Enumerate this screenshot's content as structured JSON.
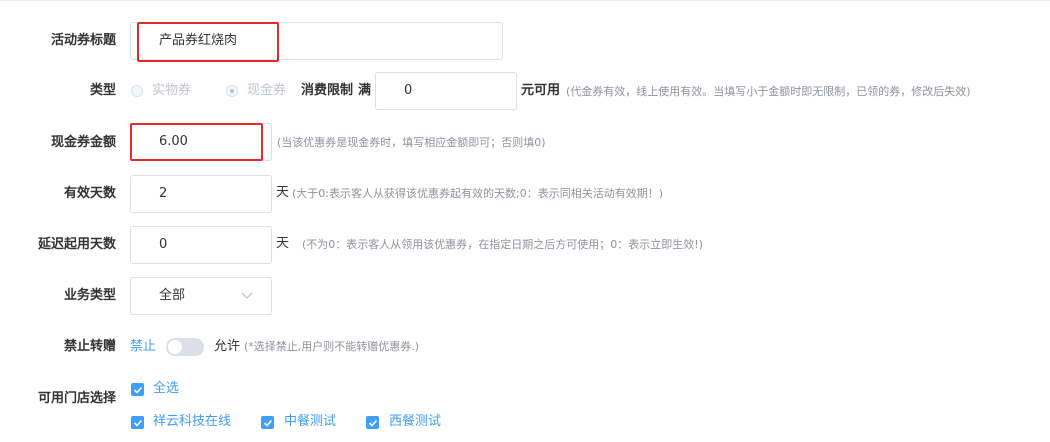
{
  "form": {
    "title": {
      "label": "活动券标题",
      "value": "产品券红烧肉"
    },
    "type": {
      "label": "类型",
      "options": [
        "实物券",
        "现金券"
      ],
      "selected": "现金券",
      "limit_label": "消费限制",
      "limit_prefix": "满",
      "limit_value": "0",
      "limit_suffix": "元可用",
      "limit_hint": "(代金券有效，线上使用有效。当填写小于金额时即无限制，已领的券，修改后失效)"
    },
    "amount": {
      "label": "现金券金额",
      "value": "6.00",
      "hint": "(当该优惠券是现金券时，填写相应金额即可；否则填0)"
    },
    "valid_days": {
      "label": "有效天数",
      "value": "2",
      "unit": "天",
      "hint": "(大于0:表示客人从获得该优惠券起有效的天数;0：表示同相关活动有效期！)"
    },
    "delay_days": {
      "label": "延迟起用天数",
      "value": "0",
      "unit": "天",
      "hint": "(不为0：表示客人从领用该优惠券，在指定日期之后方可使用；0：表示立即生效!)"
    },
    "business_type": {
      "label": "业务类型",
      "value": "全部"
    },
    "transfer": {
      "label": "禁止转赠",
      "off_label": "禁止",
      "on_label": "允许",
      "state": "off",
      "hint": "(*选择禁止,用户则不能转赠优惠券.)"
    },
    "stores": {
      "label": "可用门店选择",
      "select_all": "全选",
      "items": [
        "祥云科技在线",
        "中餐测试",
        "西餐测试"
      ]
    }
  },
  "colors": {
    "accent": "#409eff",
    "highlight_box": "#e32b2b",
    "hint": "#909399",
    "border": "#dcdfe6"
  },
  "icons": {
    "dropdown": "chevron-down-icon",
    "checkbox": "check-icon"
  }
}
